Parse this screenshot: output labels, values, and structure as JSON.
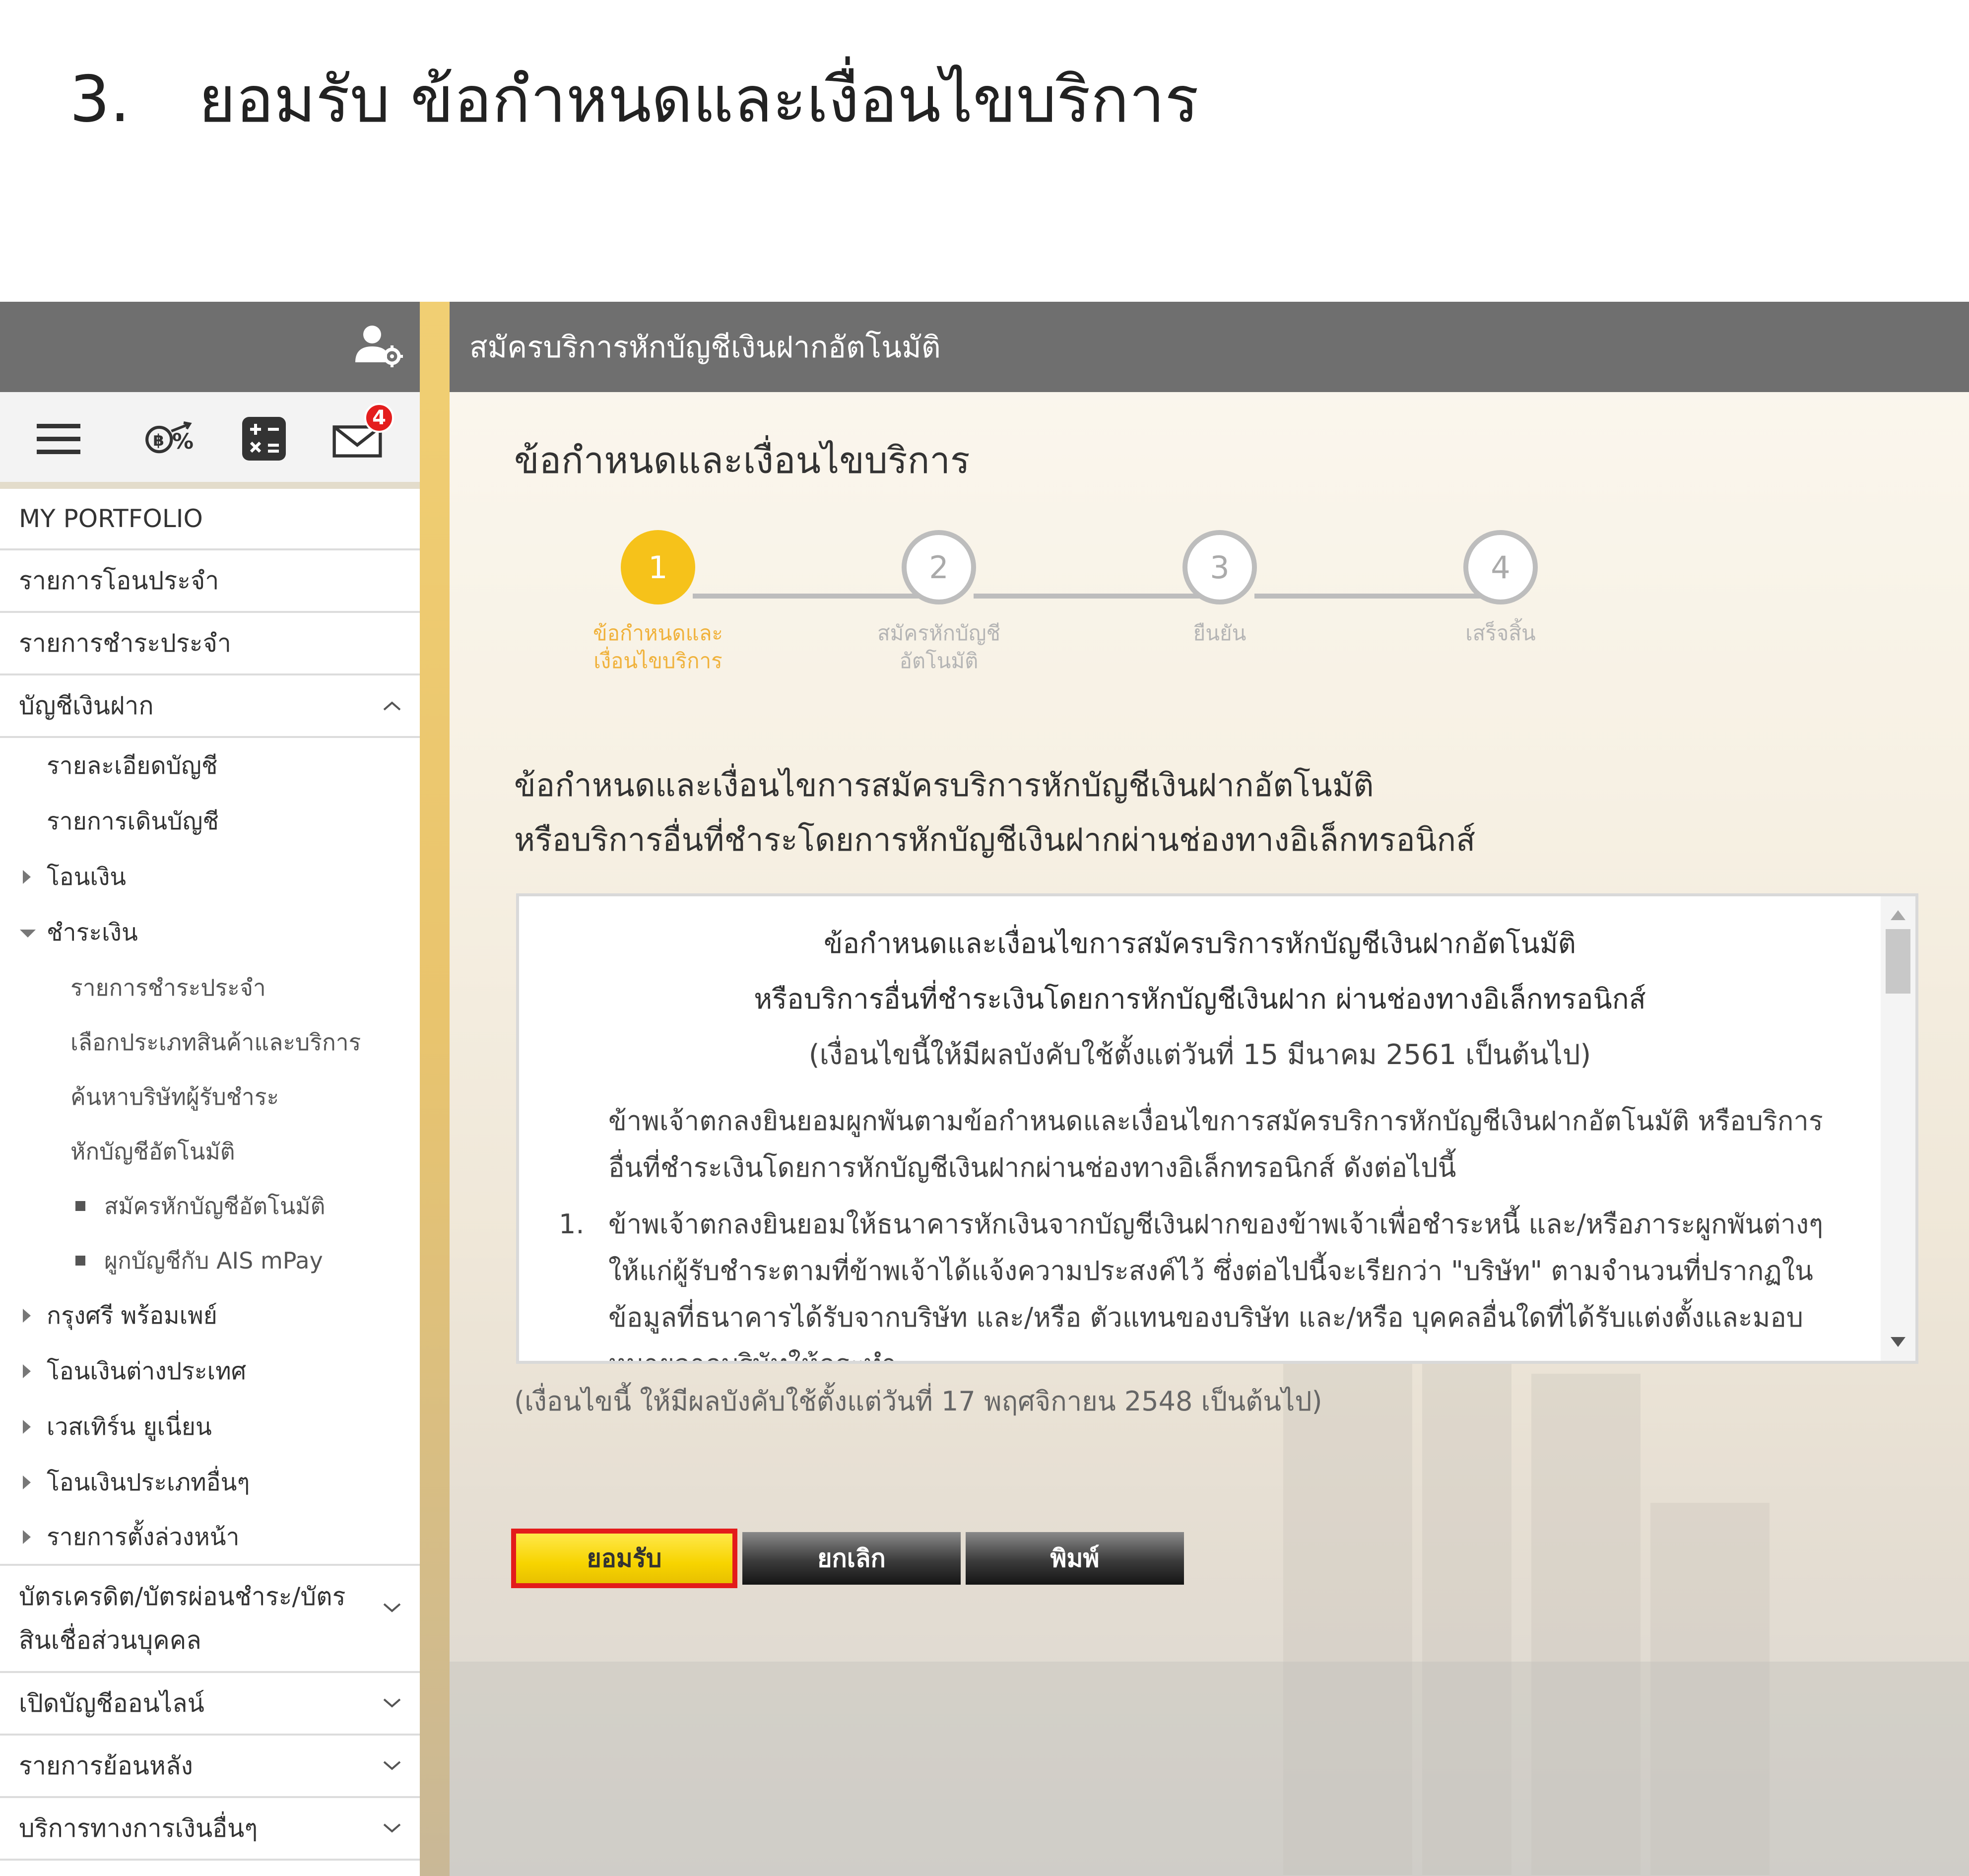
{
  "heading": {
    "number": "3.",
    "text": "ยอมรับ  ข้อกำหนดและเงื่อนไขบริการ"
  },
  "colors": {
    "accent": "#f6c21a",
    "header_bg": "#6f6f6f",
    "highlight_border": "#e31b1b",
    "badge": "#e41e1e"
  },
  "sidebar": {
    "toolbar": {
      "icons": [
        "profile-settings-icon",
        "hamburger-menu-icon",
        "fx-exchange-icon",
        "calculator-icon",
        "mail-icon"
      ],
      "mail_badge": "4"
    },
    "items": [
      {
        "label": "MY PORTFOLIO"
      },
      {
        "label": "รายการโอนประจำ"
      },
      {
        "label": "รายการชำระประจำ"
      },
      {
        "label": "บัญชีเงินฝาก"
      }
    ],
    "deposit_sub": {
      "detail": "รายละเอียดบัญชี",
      "movement": "รายการเดินบัญชี",
      "transfer": "โอนเงิน",
      "payment": "ชำระเงิน",
      "payment_children": {
        "recurring": "รายการชำระประจำ",
        "select_type": "เลือกประเภทสินค้าและบริการ",
        "search_biller": "ค้นหาบริษัทผู้รับชำระ",
        "auto_debit": "หักบัญชีอัตโนมัติ",
        "apply_auto_debit": "สมัครหักบัญชีอัตโนมัติ",
        "link_ais": "ผูกบัญชีกับ AIS mPay"
      },
      "krungsri_promptpay": "กรุงศรี พร้อมเพย์",
      "intl_transfer": "โอนเงินต่างประเทศ",
      "western_union": "เวสเทิร์น ยูเนี่ยน",
      "other_transfer": "โอนเงินประเภทอื่นๆ",
      "scheduled": "รายการตั้งล่วงหน้า"
    },
    "bottom_items": {
      "cards": "บัตรเครดิต/บัตรผ่อนชำระ/บัตร สินเชื่อส่วนบุคคล",
      "open_online": "เปิดบัญชีออนไลน์",
      "history": "รายการย้อนหลัง",
      "other_services": "บริการทางการเงินอื่นๆ"
    }
  },
  "main": {
    "header_title": "สมัครบริการหักบัญชีเงินฝากอัตโนมัติ",
    "section_title": "ข้อกำหนดและเงื่อนไขบริการ",
    "steps": [
      {
        "num": "1",
        "label_1": "ข้อกำหนดและ",
        "label_2": "เงื่อนไขบริการ"
      },
      {
        "num": "2",
        "label_1": "สมัครหักบัญชี",
        "label_2": "อัตโนมัติ"
      },
      {
        "num": "3",
        "label_1": "ยืนยัน",
        "label_2": ""
      },
      {
        "num": "4",
        "label_1": "เสร็จสิ้น",
        "label_2": ""
      }
    ],
    "current_step": 1,
    "terms_heading_1": "ข้อกำหนดและเงื่อนไขการสมัครบริการหักบัญชีเงินฝากอัตโนมัติ",
    "terms_heading_2": "หรือบริการอื่นที่ชำระโดยการหักบัญชีเงินฝากผ่านช่องทางอิเล็กทรอนิกส์",
    "terms_box": {
      "title_1": "ข้อกำหนดและเงื่อนไขการสมัครบริการหักบัญชีเงินฝากอัตโนมัติ",
      "title_2": "หรือบริการอื่นที่ชำระเงินโดยการหักบัญชีเงินฝาก ผ่านช่องทางอิเล็กทรอนิกส์",
      "effective": "(เงื่อนไขนี้ให้มีผลบังคับใช้ตั้งแต่วันที่ 15 มีนาคม 2561 เป็นต้นไป)",
      "intro": "ข้าพเจ้าตกลงยินยอมผูกพันตามข้อกำหนดและเงื่อนไขการสมัครบริการหักบัญชีเงินฝากอัตโนมัติ หรือบริการอื่นที่ชำระเงินโดยการหักบัญชีเงินฝากผ่านช่องทางอิเล็กทรอนิกส์ ดังต่อไปนี้",
      "clause_1_num": "1.",
      "clause_1": "ข้าพเจ้าตกลงยินยอมให้ธนาคารหักเงินจากบัญชีเงินฝากของข้าพเจ้าเพื่อชำระหนี้ และ/หรือภาระผูกพันต่างๆ ให้แก่ผู้รับชำระตามที่ข้าพเจ้าได้แจ้งความประสงค์ไว้ ซึ่งต่อไปนี้จะเรียกว่า \"บริษัท\" ตามจำนวนที่ปรากฏในข้อมูลที่ธนาคารได้รับจากบริษัท และ/หรือ ตัวแทนของบริษัท และ/หรือ บุคคลอื่นใดที่ได้รับแต่งตั้งและมอบหมายจากบริษัทให้กระทำ"
    },
    "effective_note": "(เงื่อนไขนี้ ให้มีผลบังคับใช้ตั้งแต่วันที่ 17 พฤศจิกายน 2548 เป็นต้นไป)",
    "buttons": {
      "accept": "ยอมรับ",
      "cancel": "ยกเลิก",
      "print": "พิมพ์"
    }
  }
}
